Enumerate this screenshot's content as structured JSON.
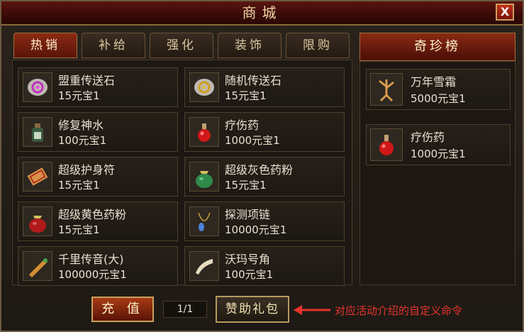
{
  "window": {
    "title": "商城",
    "close_label": "X"
  },
  "tabs": [
    {
      "label": "热销",
      "active": true
    },
    {
      "label": "补给",
      "active": false
    },
    {
      "label": "强化",
      "active": false
    },
    {
      "label": "装饰",
      "active": false
    },
    {
      "label": "限购",
      "active": false
    }
  ],
  "items": [
    {
      "name": "盟重传送石",
      "price": "15元宝1",
      "icon": "purple-teleport-stone-icon"
    },
    {
      "name": "随机传送石",
      "price": "15元宝1",
      "icon": "yellow-teleport-stone-icon"
    },
    {
      "name": "修复神水",
      "price": "100元宝1",
      "icon": "repair-potion-icon"
    },
    {
      "name": "疗伤药",
      "price": "1000元宝1",
      "icon": "red-potion-icon"
    },
    {
      "name": "超级护身符",
      "price": "15元宝1",
      "icon": "amulet-icon"
    },
    {
      "name": "超级灰色药粉",
      "price": "15元宝1",
      "icon": "green-powder-bag-icon"
    },
    {
      "name": "超级黄色药粉",
      "price": "15元宝1",
      "icon": "red-powder-bag-icon"
    },
    {
      "name": "探测项链",
      "price": "10000元宝1",
      "icon": "necklace-icon"
    },
    {
      "name": "千里传音(大)",
      "price": "100000元宝1",
      "icon": "horn-scroll-icon"
    },
    {
      "name": "沃玛号角",
      "price": "100元宝1",
      "icon": "woma-horn-icon"
    }
  ],
  "treasure": {
    "header": "奇珍榜",
    "items": [
      {
        "name": "万年雪霜",
        "price": "5000元宝1",
        "icon": "ginseng-icon"
      },
      {
        "name": "疗伤药",
        "price": "1000元宝1",
        "icon": "red-potion-icon"
      }
    ]
  },
  "footer": {
    "charge_label": "充 值",
    "page": "1/1",
    "gift_label": "赞助礼包",
    "annotation": "对应活动介绍的自定义命令"
  },
  "colors": {
    "annotation": "#e8332c",
    "active_tab": "#8a2a14"
  }
}
